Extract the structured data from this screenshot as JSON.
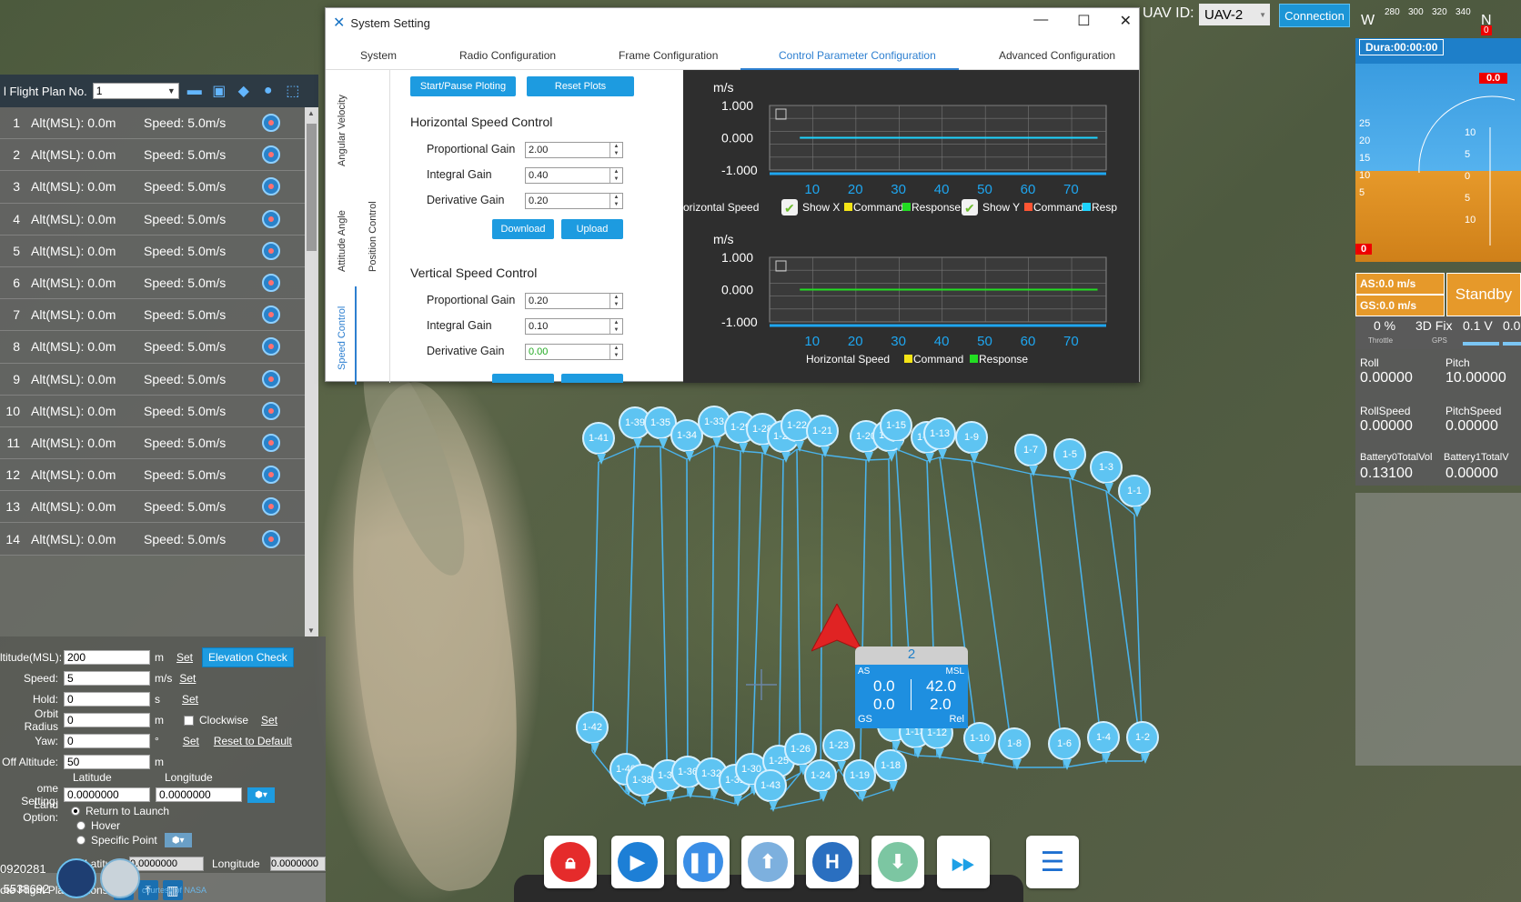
{
  "colors": {
    "accent": "#1d9be0",
    "pin": "#5ec4f2",
    "plot_bg": "#2e2e2e",
    "cyan": "#1ed4ff",
    "green": "#22dd22",
    "yellow": "#f5e416"
  },
  "flight_plan": {
    "label": "l Flight Plan No.",
    "selected": "1",
    "rows": [
      {
        "no": "1",
        "alt": "Alt(MSL): 0.0m",
        "speed": "Speed: 5.0m/s"
      },
      {
        "no": "2",
        "alt": "Alt(MSL): 0.0m",
        "speed": "Speed: 5.0m/s"
      },
      {
        "no": "3",
        "alt": "Alt(MSL): 0.0m",
        "speed": "Speed: 5.0m/s"
      },
      {
        "no": "4",
        "alt": "Alt(MSL): 0.0m",
        "speed": "Speed: 5.0m/s"
      },
      {
        "no": "5",
        "alt": "Alt(MSL): 0.0m",
        "speed": "Speed: 5.0m/s"
      },
      {
        "no": "6",
        "alt": "Alt(MSL): 0.0m",
        "speed": "Speed: 5.0m/s"
      },
      {
        "no": "7",
        "alt": "Alt(MSL): 0.0m",
        "speed": "Speed: 5.0m/s"
      },
      {
        "no": "8",
        "alt": "Alt(MSL): 0.0m",
        "speed": "Speed: 5.0m/s"
      },
      {
        "no": "9",
        "alt": "Alt(MSL): 0.0m",
        "speed": "Speed: 5.0m/s"
      },
      {
        "no": "10",
        "alt": "Alt(MSL): 0.0m",
        "speed": "Speed: 5.0m/s"
      },
      {
        "no": "11",
        "alt": "Alt(MSL): 0.0m",
        "speed": "Speed: 5.0m/s"
      },
      {
        "no": "12",
        "alt": "Alt(MSL): 0.0m",
        "speed": "Speed: 5.0m/s"
      },
      {
        "no": "13",
        "alt": "Alt(MSL): 0.0m",
        "speed": "Speed: 5.0m/s"
      },
      {
        "no": "14",
        "alt": "Alt(MSL): 0.0m",
        "speed": "Speed: 5.0m/s"
      }
    ]
  },
  "props": {
    "altitude_label": "ltitude(MSL):",
    "altitude_value": "200",
    "altitude_unit": "m",
    "speed_label": "Speed:",
    "speed_value": "5",
    "speed_unit": "m/s",
    "hold_label": "Hold:",
    "hold_value": "0",
    "hold_unit": "s",
    "orbit_label": "Orbit Radius",
    "orbit_value": "0",
    "orbit_unit": "m",
    "clockwise": "Clockwise",
    "yaw_label": "Yaw:",
    "yaw_value": "0",
    "yaw_unit": "°",
    "reset": "Reset to Default",
    "takeoff_label": "Off Altitude:",
    "takeoff_value": "50",
    "takeoff_unit": "m",
    "lat_header": "Latitude",
    "lon_header": "Longitude",
    "home_label": "ome Setting:",
    "home_lat": "0.0000000",
    "home_lon": "0.0000000",
    "land_label": "Land Option:",
    "opt_rtl": "Return to Launch",
    "opt_hover": "Hover",
    "opt_specific": "Specific Point",
    "sp_lat_label": "Latitude",
    "sp_lat": "0.0000000",
    "sp_lon_label": "Longitude",
    "sp_lon": "0.0000000",
    "set": "Set",
    "elevation_check": "Elevation Check"
  },
  "remote": {
    "label": "ote Flight Plan Actions"
  },
  "coords": {
    "line1": "0920281",
    "line2": ".5538692",
    "nasa": "courtesy of NASA"
  },
  "topbar": {
    "uav_label": "UAV ID:",
    "uav_value": "UAV-2",
    "connection": "Connection",
    "compass": [
      "W",
      "280",
      "300",
      "320",
      "340",
      "N"
    ],
    "compass_badge": "0"
  },
  "instr": {
    "dura": "Dura:00:00:00",
    "roll_badge": "0.0",
    "speed_ticks": [
      "25",
      "20",
      "15",
      "10",
      "5"
    ],
    "alt_ticks": [
      "10",
      "5",
      "0",
      "5",
      "10"
    ],
    "low_badge": "0",
    "as": "AS:0.0 m/s",
    "gs": "GS:0.0 m/s",
    "mode": "Standby",
    "throttle_val": "0 %",
    "throttle_lbl": "Throttle",
    "gps_val": "3D Fix",
    "gps_lbl": "GPS",
    "volt1": "0.1 V",
    "volt2": "0.0",
    "roll_l": "Roll",
    "roll_v": "0.00000",
    "pitch_l": "Pitch",
    "pitch_v": "10.00000",
    "rollspeed_l": "RollSpeed",
    "rollspeed_v": "0.00000",
    "pitchspeed_l": "PitchSpeed",
    "pitchspeed_v": "0.00000",
    "bat0_l": "Battery0TotalVol",
    "bat0_v": "0.13100",
    "bat1_l": "Battery1TotalV",
    "bat1_v": "0.00000"
  },
  "dialog": {
    "title": "System Setting",
    "tabs": [
      "System",
      "Radio Configuration",
      "Frame Configuration",
      "Control Parameter Configuration",
      "Advanced Configuration"
    ],
    "vtabs": [
      "Angular Velocity",
      "Attitude Angle",
      "Position Control",
      "Speed Control"
    ],
    "start_pause": "Start/Pause Ploting",
    "reset_plots": "Reset Plots",
    "h_title": "Horizontal Speed Control",
    "v_title": "Vertical Speed Control",
    "pg_label": "Proportional Gain",
    "ig_label": "Integral Gain",
    "dg_label": "Derivative Gain",
    "h_pg": "2.00",
    "h_ig": "0.40",
    "h_dg": "0.20",
    "v_pg": "0.20",
    "v_ig": "0.10",
    "v_dg": "0.00",
    "download": "Download",
    "upload": "Upload"
  },
  "chart_data": [
    {
      "type": "line",
      "ylabel": "m/s",
      "ylim": [
        -1,
        1
      ],
      "y_ticks": [
        "1.000",
        "0.000",
        "-1.000"
      ],
      "x_ticks": [
        "10",
        "20",
        "30",
        "40",
        "50",
        "60",
        "70"
      ],
      "xlim": [
        0,
        78
      ],
      "legend_prefix": "orizontal Speed",
      "legend": [
        "Show X",
        "Command",
        "Response",
        "Show Y",
        "Command",
        "Resp"
      ],
      "series": [
        {
          "name": "Response",
          "color": "#1ed4ff",
          "x": [
            7,
            76
          ],
          "y": [
            0,
            0
          ]
        }
      ]
    },
    {
      "type": "line",
      "ylabel": "m/s",
      "ylim": [
        -1,
        1
      ],
      "y_ticks": [
        "1.000",
        "0.000",
        "-1.000"
      ],
      "x_ticks": [
        "10",
        "20",
        "30",
        "40",
        "50",
        "60",
        "70"
      ],
      "xlim": [
        0,
        78
      ],
      "legend_prefix": "Horizontal Speed",
      "legend": [
        "Command",
        "Response"
      ],
      "series": [
        {
          "name": "Response",
          "color": "#22dd22",
          "x": [
            7,
            76
          ],
          "y": [
            0,
            0
          ]
        }
      ]
    }
  ],
  "pins": [
    "1-41",
    "1-39",
    "1-35",
    "1-34",
    "1-33",
    "1-29",
    "1-28",
    "1-27",
    "1-22",
    "1-21",
    "1-20",
    "1-16",
    "1-15",
    "1-14",
    "1-13",
    "1-9",
    "1-7",
    "1-5",
    "1-3",
    "1-1",
    "1-42",
    "1-40",
    "1-38",
    "1-37",
    "1-36",
    "1-32",
    "1-31",
    "1-30",
    "1-25",
    "1-26",
    "1-43",
    "1-24",
    "1-23",
    "1-19",
    "1-18",
    "1-17",
    "1-13",
    "1-12",
    "1-10",
    "1-8",
    "1-6",
    "1-4",
    "1-2"
  ],
  "hud": {
    "id": "2",
    "as_lbl": "AS",
    "msl_lbl": "MSL",
    "as_v": "0.0",
    "msl_v": "42.0",
    "gs_v": "0.0",
    "rel_v": "2.0",
    "gs_lbl": "GS",
    "rel_lbl": "Rel"
  },
  "controls": [
    "lock-icon",
    "play-icon",
    "pause-icon",
    "takeoff-arrow-icon",
    "home-h-icon",
    "land-arrow-icon",
    "fast-forward-icon",
    "list-icon"
  ],
  "controls_text": {
    "home": "H"
  }
}
